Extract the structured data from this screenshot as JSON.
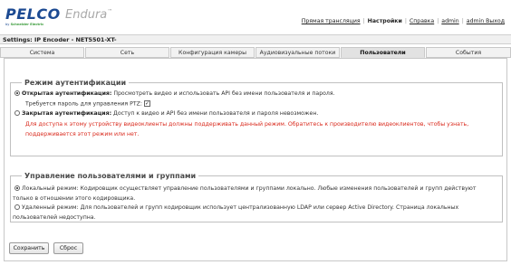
{
  "brand": {
    "logo": "PELCO",
    "logo_sub_prefix": "by",
    "logo_sub": "Schneider Electric",
    "product": "Endura",
    "product_mark": "™"
  },
  "topnav": {
    "items": [
      {
        "label": "Прямая трансляция",
        "active": false
      },
      {
        "label": "Настройки",
        "active": true
      },
      {
        "label": "Справка",
        "active": false
      },
      {
        "label": "admin",
        "active": false
      },
      {
        "label": "admin Выход",
        "active": false
      }
    ]
  },
  "settings_title": "Settings: IP Encoder - NET5501-XT-",
  "tabs": [
    "Система",
    "Сеть",
    "Конфигурация камеры",
    "Аудиовизуальные потоки",
    "Пользователи",
    "События"
  ],
  "active_tab": "Пользователи",
  "auth": {
    "legend": "Режим аутентификации",
    "open_label": "Открытая аутентификация:",
    "open_desc": " Просмотреть видео и использовать API без имени пользователя и пароля.",
    "ptz_label": "Требуется пароль для управления PTZ:",
    "ptz_checked": true,
    "closed_label": "Закрытая аутентификация:",
    "closed_desc": " Доступ к видео и API без имени пользователя и пароля невозможен.",
    "warning_line1": "Для доступа к этому устройству видеоклиенты должны поддерживать данный режим. Обратитесь к производителю видеоклиентов, чтобы узнать,",
    "warning_line2": "поддерживается этот режим или нет.",
    "selected": "open"
  },
  "users": {
    "legend": "Управление пользователями и группами",
    "local_line1": "Локальный режим: Кодировщик осуществляет управление пользователями и группами локально. Любые изменения пользователей и групп действуют",
    "local_line2": "только в отношении этого кодировщика.",
    "remote_line1": "Удаленный режим: Для пользователей и групп кодировщик использует централизованную LDAP или сервер Active Directory. Страница локальных",
    "remote_line2": "пользователей недоступна.",
    "selected": "local"
  },
  "buttons": {
    "save": "Сохранить",
    "reset": "Сброс"
  }
}
